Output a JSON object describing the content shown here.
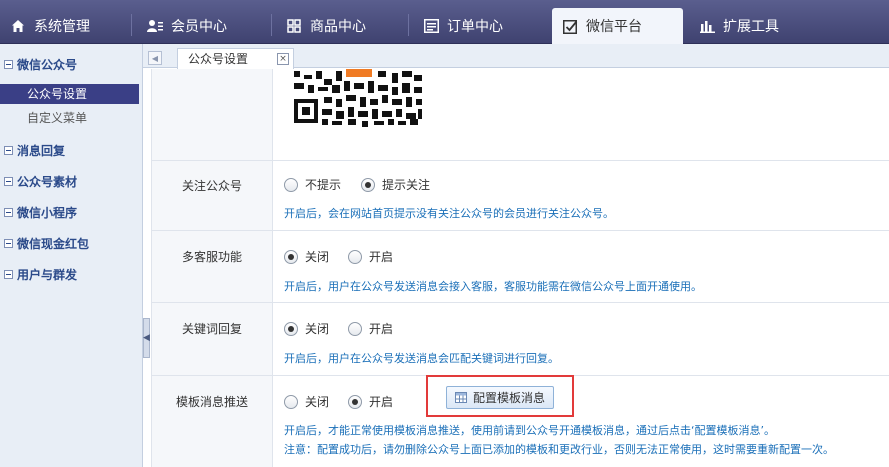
{
  "topnav": {
    "tabs": [
      {
        "label": "系统管理",
        "icon": "home-icon"
      },
      {
        "label": "会员中心",
        "icon": "member-icon"
      },
      {
        "label": "商品中心",
        "icon": "grid-icon"
      },
      {
        "label": "订单中心",
        "icon": "list-icon"
      },
      {
        "label": "微信平台",
        "icon": "checkbox-icon",
        "active": true
      },
      {
        "label": "扩展工具",
        "icon": "bar-chart-icon"
      }
    ]
  },
  "sidebar": {
    "groups": [
      {
        "label": "微信公众号",
        "items": [
          {
            "label": "公众号设置",
            "active": true
          },
          {
            "label": "自定义菜单"
          }
        ]
      },
      {
        "label": "消息回复"
      },
      {
        "label": "公众号素材"
      },
      {
        "label": "微信小程序"
      },
      {
        "label": "微信现金红包"
      },
      {
        "label": "用户与群发"
      }
    ]
  },
  "tabbar": {
    "page_tab": "公众号设置",
    "close": "×",
    "scroll_left": "◀"
  },
  "form": {
    "follow": {
      "label": "关注公众号",
      "options": [
        "不提示",
        "提示关注"
      ],
      "selected": "提示关注",
      "hint": "开启后，会在网站首页提示没有关注公众号的会员进行关注公众号。"
    },
    "customer_service": {
      "label": "多客服功能",
      "options": [
        "关闭",
        "开启"
      ],
      "selected": "关闭",
      "hint": "开启后，用户在公众号发送消息会接入客服，客服功能需在微信公众号上面开通使用。"
    },
    "keyword_reply": {
      "label": "关键词回复",
      "options": [
        "关闭",
        "开启"
      ],
      "selected": "关闭",
      "hint": "开启后，用户在公众号发送消息会匹配关键词进行回复。"
    },
    "template_push": {
      "label": "模板消息推送",
      "options": [
        "关闭",
        "开启"
      ],
      "selected": "开启",
      "button": "配置模板消息",
      "hint": "开启后，才能正常使用模板消息推送，使用前请到公众号开通模板消息，通过后点击‘配置模板消息’。",
      "note": "注意：配置成功后，请勿删除公众号上面已添加的模板和更改行业，否则无法正常使用，这时需要重新配置一次。"
    }
  },
  "colors": {
    "nav_bg": "#474a7c",
    "active_item": "#3a3f86",
    "hint": "#1a6fb8",
    "highlight": "#e23a3a"
  }
}
